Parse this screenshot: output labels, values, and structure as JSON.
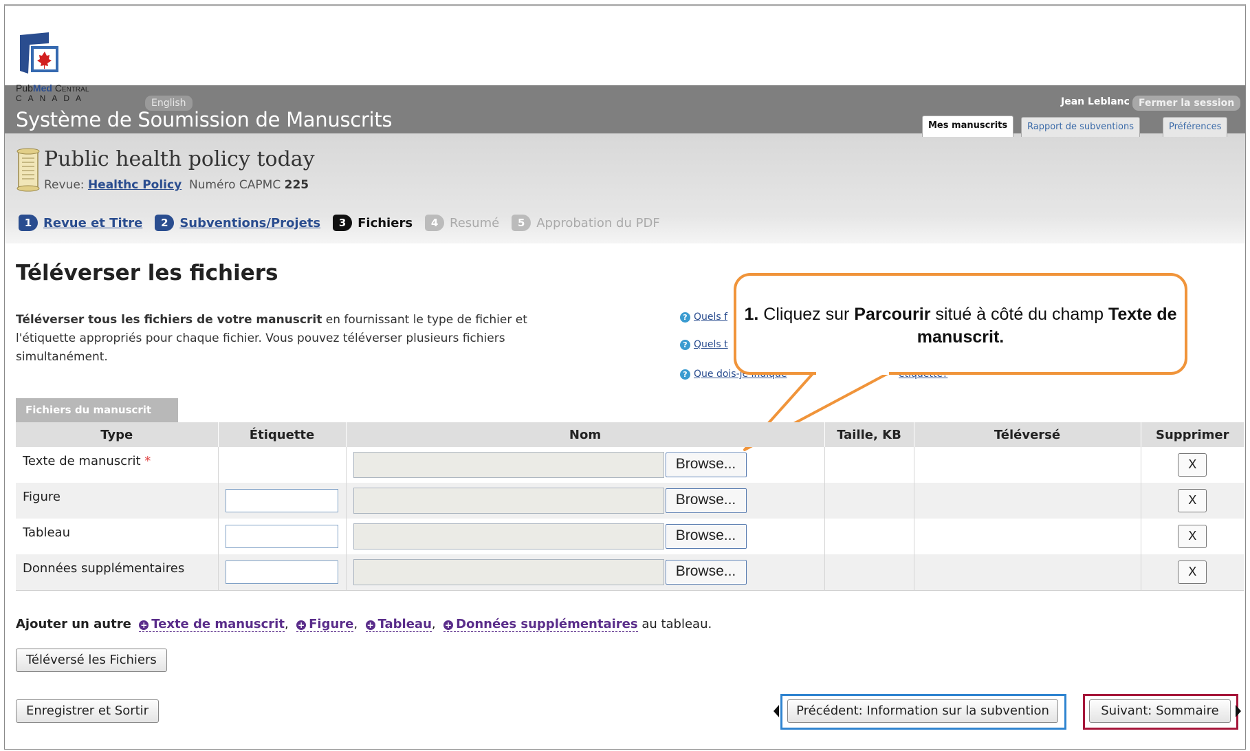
{
  "brand": {
    "line1_a": "Pub",
    "line1_b": "Med",
    "line1_c": "Central",
    "line2": "CANADA"
  },
  "header": {
    "language_link": "English",
    "system_title": "Système de Soumission de Manuscrits",
    "user_name": "Jean Leblanc",
    "logout": "Fermer la session",
    "tabs": [
      {
        "label": "Mes manuscrits"
      },
      {
        "label": "Rapport de subventions"
      },
      {
        "label": "Préférences"
      }
    ]
  },
  "manuscript": {
    "title": "Public health policy today",
    "journal_prefix": "Revue:",
    "journal_name": "Healthc Policy",
    "capmc_label": "Numéro CAPMC",
    "capmc_number": "225"
  },
  "steps": [
    {
      "num": "1",
      "label": "Revue et Titre"
    },
    {
      "num": "2",
      "label": "Subventions/Projets"
    },
    {
      "num": "3",
      "label": "Fichiers"
    },
    {
      "num": "4",
      "label": "Resumé"
    },
    {
      "num": "5",
      "label": "Approbation du PDF"
    }
  ],
  "page": {
    "heading": "Téléverser les fichiers",
    "intro_bold": "Téléverser tous les fichiers de votre manuscrit",
    "intro_rest": " en fournissant le type de fichier et l'étiquette appropriés pour chaque fichier. Vous pouvez téléverser plusieurs fichiers simultanément.",
    "help_links": [
      "Quels f",
      "Quels t",
      "Que dois-je indique"
    ],
    "help_tail": "étiquette?"
  },
  "callout": {
    "num": "1.",
    "t1": " Cliquez sur ",
    "b1": "Parcourir",
    "t2": " situé à côté du champ ",
    "b2": "Texte de manuscrit."
  },
  "table": {
    "tab_label": "Fichiers du manuscrit",
    "headers": [
      "Type",
      "Étiquette",
      "Nom",
      "Taille, KB",
      "Téléversé",
      "Supprimer"
    ],
    "browse_label": "Browse...",
    "delete_label": "X",
    "rows": [
      {
        "type": "Texte de manuscrit",
        "required_mark": "*"
      },
      {
        "type": "Figure"
      },
      {
        "type": "Tableau"
      },
      {
        "type": "Données supplémentaires"
      }
    ]
  },
  "add": {
    "prefix": "Ajouter un autre",
    "links": [
      "Texte de manuscrit",
      "Figure",
      "Tableau",
      "Données supplémentaires"
    ],
    "suffix": "au tableau."
  },
  "buttons": {
    "upload": "Téléversé les Fichiers",
    "save_exit": "Enregistrer et Sortir",
    "previous": "Précédent: Information sur la subvention",
    "next": "Suivant: Sommaire"
  },
  "colors": {
    "brand_blue": "#2a4d8f",
    "callout_orange": "#f0943a",
    "highlight_blue": "#2f84d0",
    "highlight_red": "#a6163a"
  }
}
